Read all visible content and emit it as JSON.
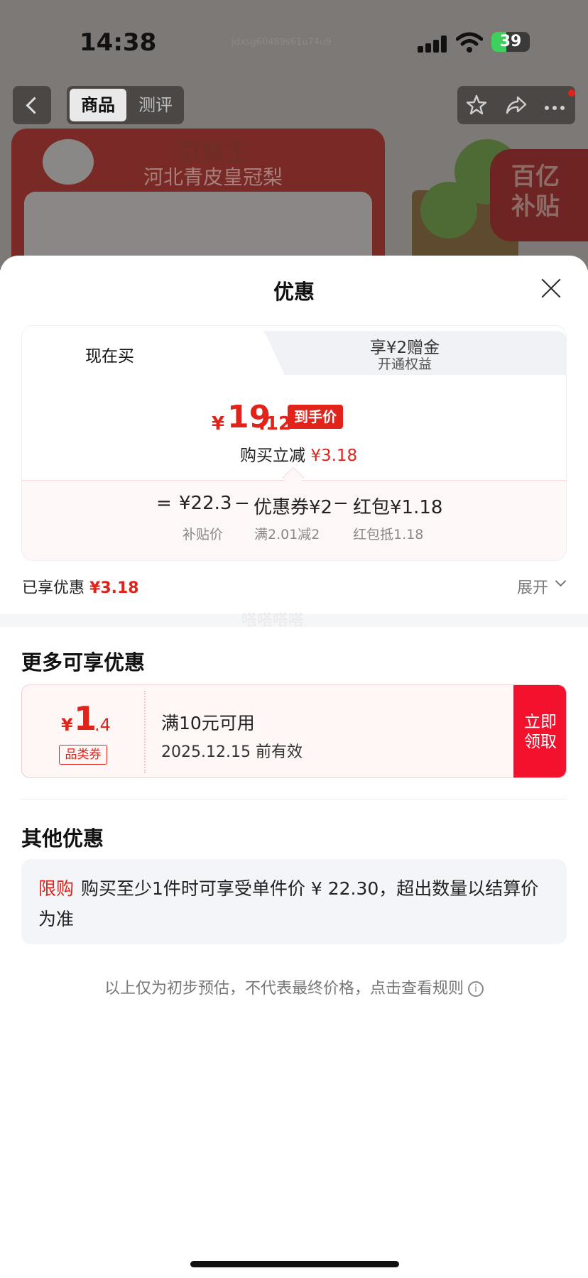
{
  "status": {
    "time": "14:38",
    "battery": "39",
    "battery_level": 0.39
  },
  "watermark": {
    "top": "jdxsg60489s61u74u9",
    "mid": "嗒嗒嗒嗒"
  },
  "header": {
    "tab_product": "商品",
    "tab_review": "测评"
  },
  "banner": {
    "brand": "京鲜生",
    "title": "河北青皮皇冠梨",
    "subsidy_line1": "百亿",
    "subsidy_line2": "补贴"
  },
  "sheet": {
    "title": "优惠"
  },
  "price_tabs": {
    "current": "现在买",
    "gift_title": "享¥2赠金",
    "gift_sub": "开通权益"
  },
  "price": {
    "yen": "¥",
    "int": "19",
    "dec": ".12",
    "tag": "到手价",
    "reduce_label": "购买立减",
    "reduce_amount": "¥3.18"
  },
  "breakdown": {
    "eq": "=",
    "subsidy_value": "¥22.3",
    "subsidy_label": "补贴价",
    "minus1": "−",
    "coupon_value": "优惠券¥2",
    "coupon_label": "满2.01减2",
    "minus2": "−",
    "redpack_value": "红包¥1.18",
    "redpack_label": "红包抵1.18"
  },
  "enjoyed": {
    "label": "已享优惠",
    "amount": "¥3.18",
    "expand": "展开"
  },
  "more": {
    "title": "更多可享优惠"
  },
  "coupon": {
    "yen": "¥",
    "int": "1",
    "dec": ".4",
    "tag": "品类券",
    "condition": "满10元可用",
    "expiry": "2025.12.15 前有效",
    "btn_line1": "立即",
    "btn_line2": "领取"
  },
  "other": {
    "title": "其他优惠",
    "badge": "限购",
    "text": "购买至少1件时可享受单件价 ¥ 22.30，超出数量以结算价为准"
  },
  "note": {
    "text": "以上仅为初步预估，不代表最终价格，点击查看规则"
  },
  "icons": {
    "back": "back-icon",
    "star": "star-icon",
    "share": "share-icon",
    "more": "more-icon",
    "close": "close-icon",
    "info": "info-icon",
    "chevron": "chevron-down-icon"
  },
  "colors": {
    "accent": "#e2231a",
    "button": "#f4112d"
  }
}
